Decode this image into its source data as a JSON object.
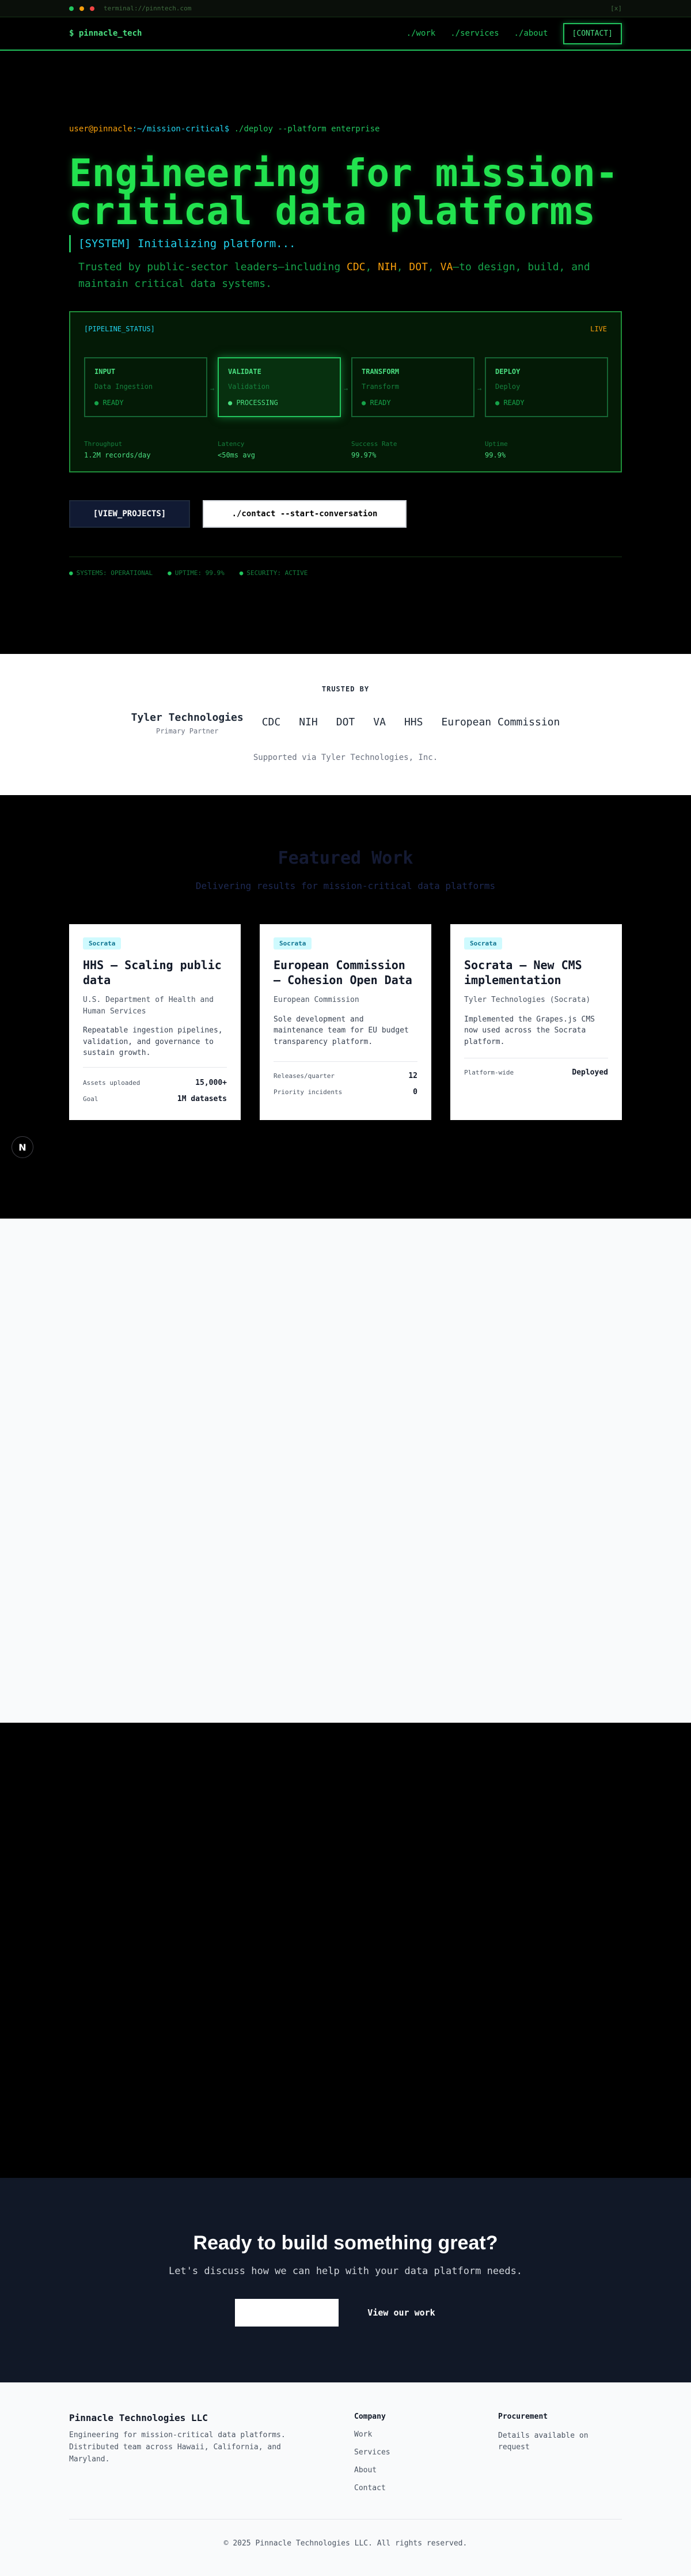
{
  "terminal_bar": {
    "url": "terminal://pinntech.com",
    "close": "[x]",
    "dot_colors": [
      "#22c55e",
      "#f59e0b",
      "#ef4444"
    ]
  },
  "nav": {
    "brand": "$ pinnacle_tech",
    "links": [
      "./work",
      "./services",
      "./about"
    ],
    "contact": "[CONTACT]"
  },
  "hero": {
    "prompt_user": "user@pinnacle",
    "prompt_path": ":~/mission-critical$",
    "prompt_cmd": " ./deploy --platform enterprise",
    "title": "Engineering for mission-critical data platforms",
    "system_line": "[SYSTEM] Initializing platform...",
    "trusted_prefix": "Trusted by public-sector leaders—including ",
    "trusted_orgs": [
      "CDC",
      "NIH",
      "DOT",
      "VA"
    ],
    "trusted_suffix": "—to design, build, and maintain critical data systems.",
    "pipeline": {
      "label": "[PIPELINE_STATUS]",
      "live": "LIVE",
      "stages": [
        {
          "name": "INPUT",
          "desc": "Data Ingestion",
          "state": "● READY",
          "active": false
        },
        {
          "name": "VALIDATE",
          "desc": "Validation",
          "state": "● PROCESSING",
          "active": true
        },
        {
          "name": "TRANSFORM",
          "desc": "Transform",
          "state": "● READY",
          "active": false
        },
        {
          "name": "DEPLOY",
          "desc": "Deploy",
          "state": "● READY",
          "active": false
        }
      ],
      "arrows": [
        "→",
        "→",
        "→"
      ],
      "metrics": [
        {
          "label": "Throughput",
          "value": "1.2M records/day"
        },
        {
          "label": "Latency",
          "value": "<50ms avg"
        },
        {
          "label": "Success Rate",
          "value": "99.97%"
        },
        {
          "label": "Uptime",
          "value": "99.9%"
        }
      ]
    },
    "btn_projects": "[VIEW_PROJECTS]",
    "btn_contact": "./contact --start-conversation",
    "status": [
      "SYSTEMS: OPERATIONAL",
      "UPTIME: 99.9%",
      "SECURITY: ACTIVE"
    ]
  },
  "trusted": {
    "heading": "TRUSTED BY",
    "primary": {
      "name": "Tyler Technologies",
      "sub": "Primary Partner"
    },
    "others": [
      "CDC",
      "NIH",
      "DOT",
      "VA",
      "HHS",
      "European Commission"
    ],
    "support": "Supported via Tyler Technologies, Inc."
  },
  "featured": {
    "title": "Featured Work",
    "subtitle": "Delivering results for mission-critical data platforms",
    "cards": [
      {
        "badge": "Socrata",
        "title": "HHS — Scaling public data",
        "org": "U.S. Department of Health and Human Services",
        "desc": "Repeatable ingestion pipelines, validation, and governance to sustain growth.",
        "stats": [
          {
            "k": "Assets uploaded",
            "v": "15,000+"
          },
          {
            "k": "Goal",
            "v": "1M datasets"
          }
        ]
      },
      {
        "badge": "Socrata",
        "title": "European Commission — Cohesion Open Data",
        "org": "European Commission",
        "desc": "Sole development and maintenance team for EU budget transparency platform.",
        "stats": [
          {
            "k": "Releases/quarter",
            "v": "12"
          },
          {
            "k": "Priority incidents",
            "v": "0"
          }
        ]
      },
      {
        "badge": "Socrata",
        "title": "Socrata — New CMS implementation",
        "org": "Tyler Technologies (Socrata)",
        "desc": "Implemented the Grapes.js CMS now used across the Socrata platform.",
        "stats": [
          {
            "k": "Platform-wide",
            "v": "Deployed"
          }
        ]
      }
    ],
    "n_badge": "N"
  },
  "cta": {
    "title": "Ready to build something great?",
    "subtitle": "Let's discuss how we can help with your data platform needs.",
    "link": "View our work"
  },
  "footer": {
    "company": "Pinnacle Technologies LLC",
    "desc": "Engineering for mission-critical data platforms. Distributed team across Hawaii, California, and Maryland.",
    "company_col": {
      "heading": "Company",
      "links": [
        "Work",
        "Services",
        "About",
        "Contact"
      ]
    },
    "procurement_col": {
      "heading": "Procurement",
      "text": "Details available on request"
    },
    "copyright": "© 2025 Pinnacle Technologies LLC. All rights reserved."
  }
}
